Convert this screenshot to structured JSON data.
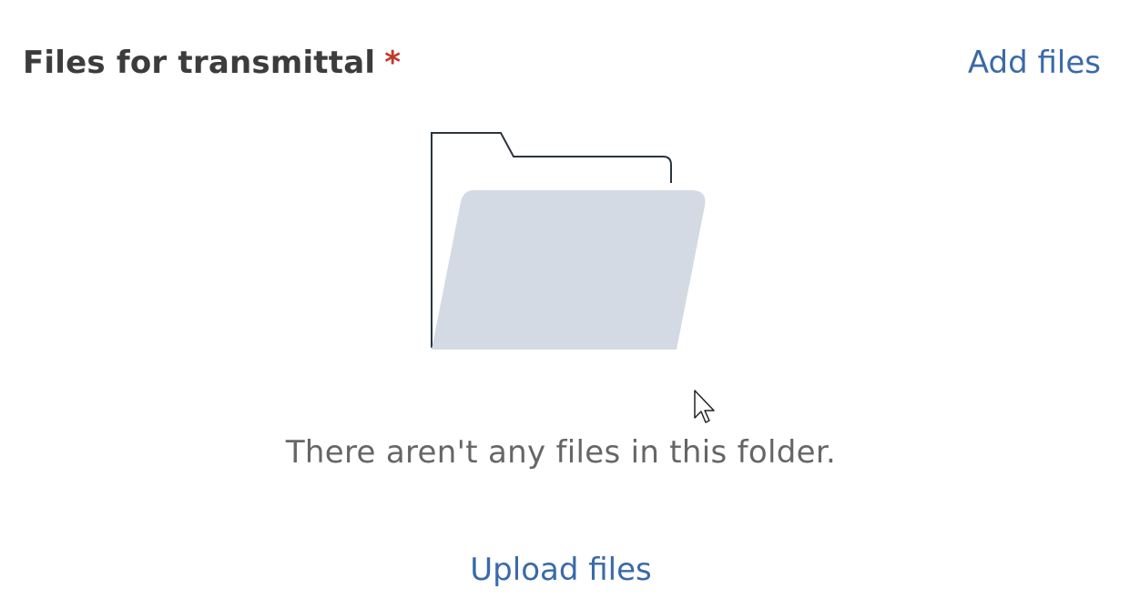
{
  "header": {
    "title": "Files for transmittal",
    "required_marker": "*",
    "add_files_label": "Add files"
  },
  "empty_state": {
    "icon": "empty-folder-illustration",
    "message": "There aren't any files in this folder.",
    "upload_label": "Upload files"
  },
  "colors": {
    "title": "#3c3c3c",
    "link": "#3a6aa8",
    "required": "#c0392b",
    "message": "#666666",
    "folder_fill": "#d3dae3",
    "folder_outline": "#2b3440"
  }
}
